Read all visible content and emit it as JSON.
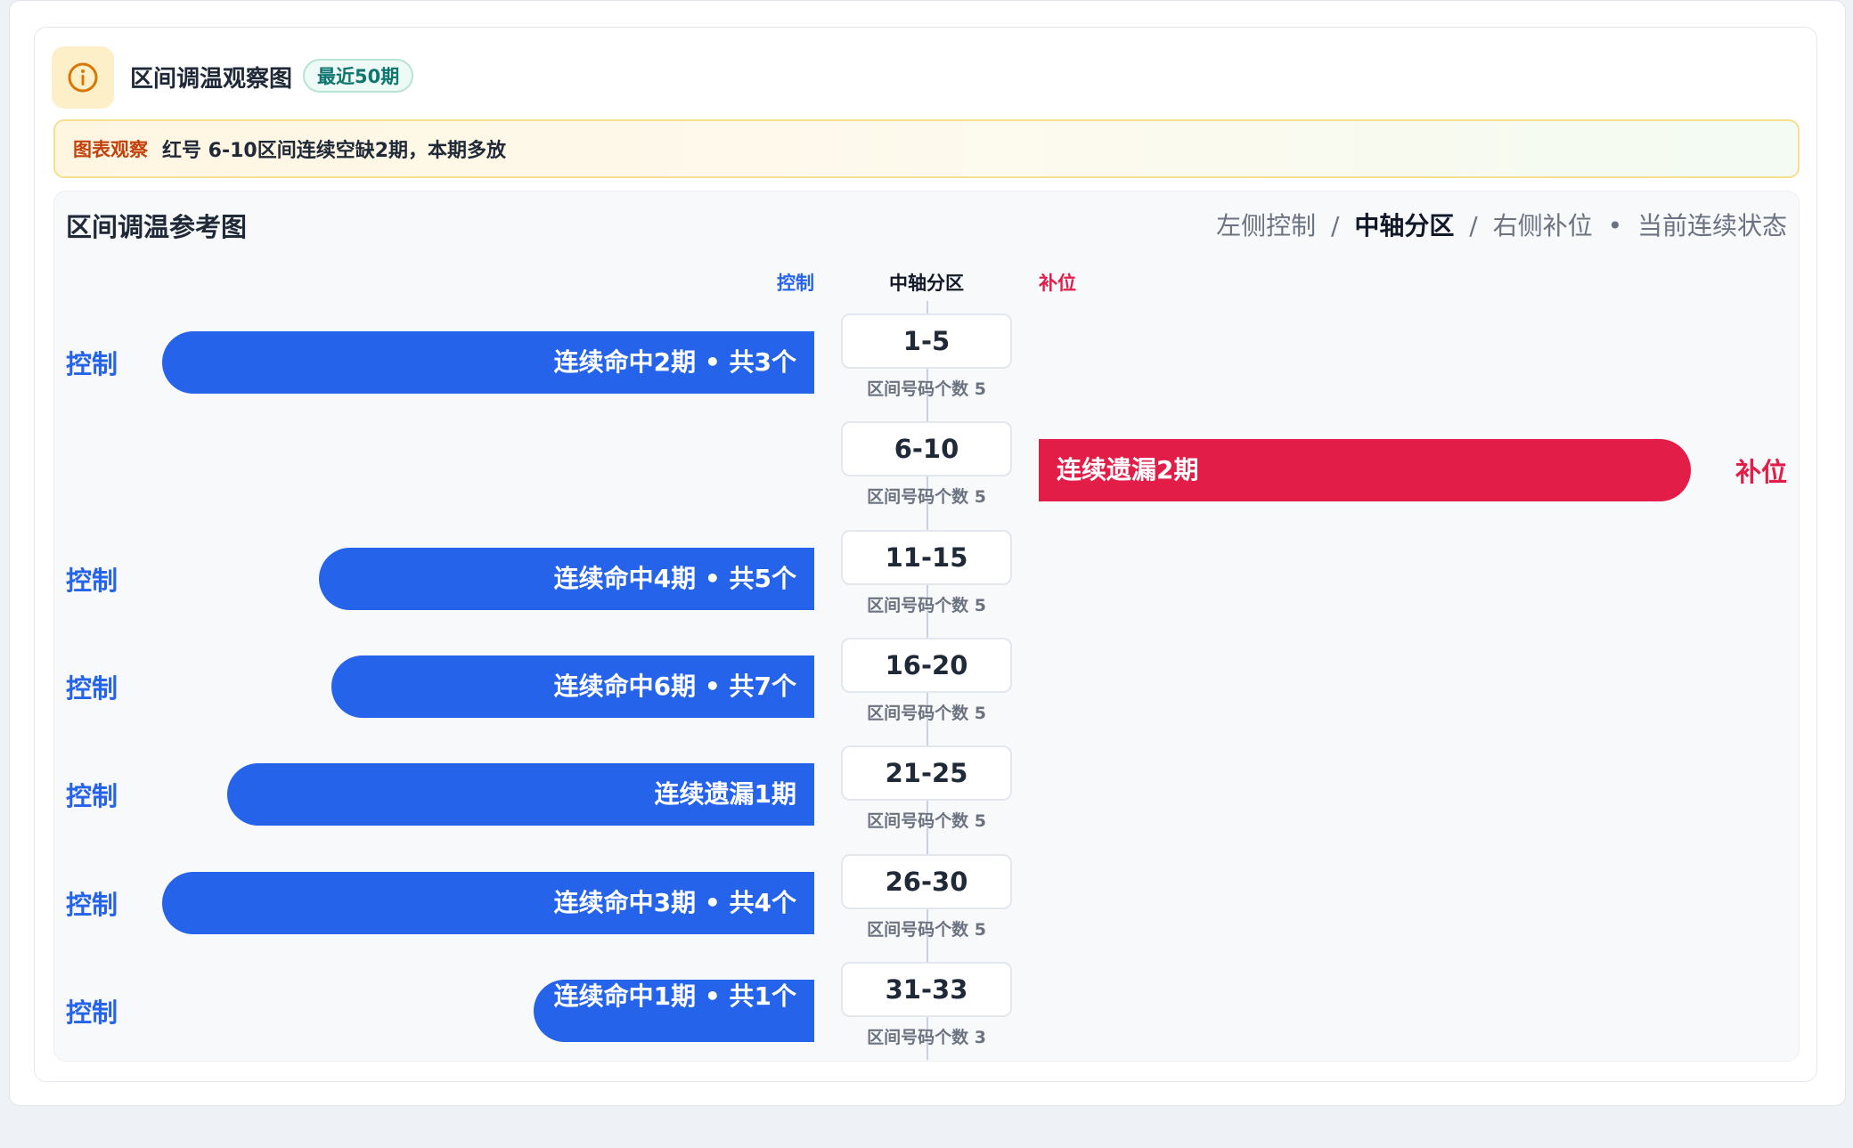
{
  "header": {
    "icon": "info-icon",
    "title": "区间调温观察图",
    "badge": "最近50期"
  },
  "notice": {
    "tag": "图表观察",
    "message": "红号 6-10区间连续空缺2期，本期多放"
  },
  "panel": {
    "title": "区间调温参考图",
    "legend": {
      "left": "左侧控制",
      "sep1": "/",
      "mid": "中轴分区",
      "sep2": "/",
      "right": "右侧补位",
      "dot": "•",
      "state": "当前连续状态"
    },
    "columns": {
      "left": "控制",
      "mid": "中轴分区",
      "right": "补位"
    }
  },
  "colors": {
    "control": "#2563eb",
    "fill": "#e11d48",
    "warn": "#c2410c"
  },
  "rows": [
    {
      "zone": "1-5",
      "count_text": "区间号码个数 5",
      "side": "left",
      "side_label": "控制",
      "bar_text": "连续命中2期 • 共3个",
      "magnitude": 1.0
    },
    {
      "zone": "6-10",
      "count_text": "区间号码个数 5",
      "side": "right",
      "side_label": "补位",
      "bar_text": "连续遗漏2期",
      "magnitude": 1.0
    },
    {
      "zone": "11-15",
      "count_text": "区间号码个数 5",
      "side": "left",
      "side_label": "控制",
      "bar_text": "连续命中4期 • 共5个",
      "magnitude": 0.76
    },
    {
      "zone": "16-20",
      "count_text": "区间号码个数 5",
      "side": "left",
      "side_label": "控制",
      "bar_text": "连续命中6期 • 共7个",
      "magnitude": 0.74
    },
    {
      "zone": "21-25",
      "count_text": "区间号码个数 5",
      "side": "left",
      "side_label": "控制",
      "bar_text": "连续遗漏1期",
      "magnitude": 0.9
    },
    {
      "zone": "26-30",
      "count_text": "区间号码个数 5",
      "side": "left",
      "side_label": "控制",
      "bar_text": "连续命中3期 • 共4个",
      "magnitude": 1.0
    },
    {
      "zone": "31-33",
      "count_text": "区间号码个数 3",
      "side": "left",
      "side_label": "控制",
      "bar_text": "连续命中1期 • 共1个",
      "magnitude": 0.43
    }
  ]
}
